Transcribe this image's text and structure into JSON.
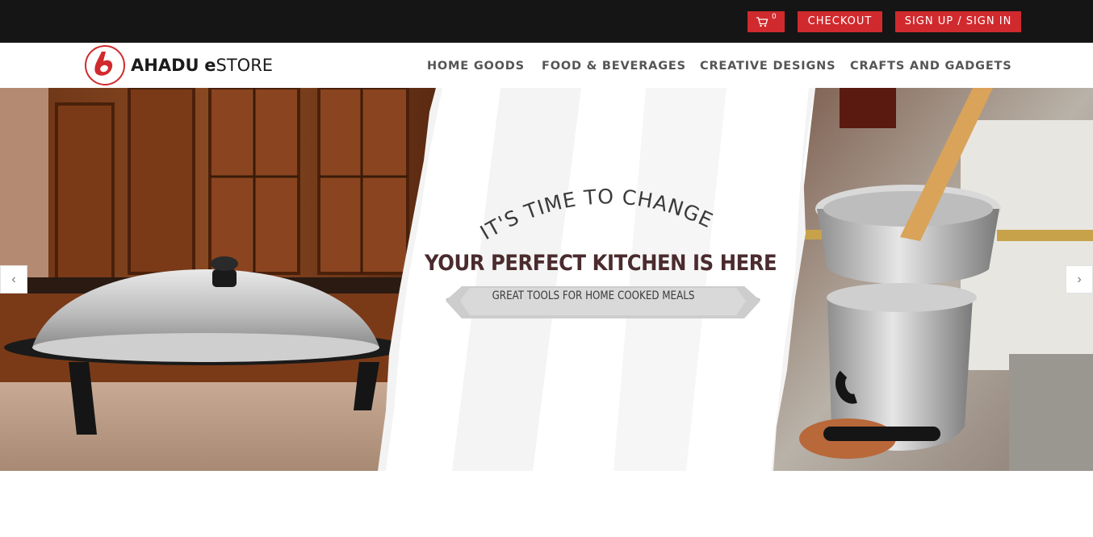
{
  "topbar": {
    "cart_count": "0",
    "checkout_label": "CHECKOUT",
    "signin_label": "SIGN UP / SIGN IN"
  },
  "brand": {
    "name_bold": "AHADU",
    "name_e": "e",
    "name_rest": "STORE",
    "accent": "#d02a2e"
  },
  "nav": {
    "items": [
      {
        "label": "HOME GOODS"
      },
      {
        "label": "FOOD & BEVERAGES"
      },
      {
        "label": "CREATIVE DESIGNS"
      },
      {
        "label": "CRAFTS AND GADGETS"
      }
    ]
  },
  "hero": {
    "tagline": "IT'S TIME TO CHANGE",
    "headline": "YOUR PERFECT KITCHEN IS HERE",
    "ribbon": "GREAT TOOLS FOR HOME COOKED MEALS",
    "prev_icon": "‹",
    "next_icon": "›"
  }
}
